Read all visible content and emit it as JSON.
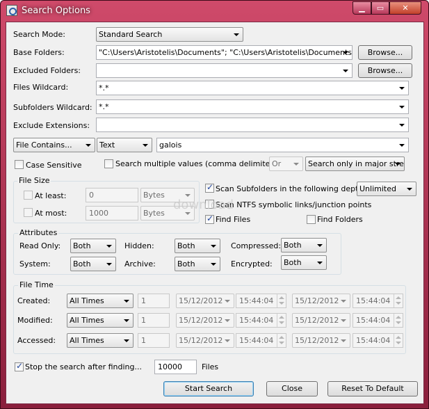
{
  "window": {
    "title": "Search Options",
    "min": "▁",
    "max": "▭",
    "close": "✕"
  },
  "labels": {
    "search_mode": "Search Mode:",
    "base_folders": "Base Folders:",
    "excluded_folders": "Excluded Folders:",
    "files_wildcard": "Files Wildcard:",
    "subfolders_wildcard": "Subfolders Wildcard:",
    "exclude_extensions": "Exclude Extensions:"
  },
  "fields": {
    "search_mode": "Standard Search",
    "base_folders": "\"C:\\Users\\Aristotelis\\Documents\"; \"C:\\Users\\Aristotelis\\Documents\\Uni\"",
    "excluded_folders": "",
    "files_wildcard": "*.*",
    "subfolders_wildcard": "*.*",
    "exclude_extensions": ""
  },
  "buttons": {
    "browse": "Browse...",
    "start": "Start Search",
    "close": "Close",
    "reset": "Reset To Default"
  },
  "contains": {
    "mode": "File Contains...",
    "type": "Text",
    "value": "galois",
    "case_sensitive": "Case Sensitive",
    "multiple": "Search multiple values (comma delimited)",
    "logic": "Or",
    "scope": "Search only in major strea"
  },
  "file_size": {
    "title": "File Size",
    "at_least": "At least:",
    "at_least_value": "0",
    "at_least_unit": "Bytes",
    "at_most": "At most:",
    "at_most_value": "1000",
    "at_most_unit": "Bytes"
  },
  "scan": {
    "subfolders": "Scan Subfolders in the following depth:",
    "depth": "Unlimited",
    "ntfs": "Scan NTFS symbolic links/junction points",
    "find_files": "Find Files",
    "find_folders": "Find Folders"
  },
  "attributes": {
    "title": "Attributes",
    "read_only": "Read Only:",
    "hidden": "Hidden:",
    "compressed": "Compressed:",
    "system": "System:",
    "archive": "Archive:",
    "encrypted": "Encrypted:",
    "value": "Both"
  },
  "file_time": {
    "title": "File Time",
    "created": "Created:",
    "modified": "Modified:",
    "accessed": "Accessed:",
    "mode": "All Times",
    "count": "1",
    "date": "15/12/2012",
    "time": "15:44:04"
  },
  "stop": {
    "label": "Stop the search after finding...",
    "count": "10000",
    "unit": "Files"
  },
  "watermark": "download"
}
